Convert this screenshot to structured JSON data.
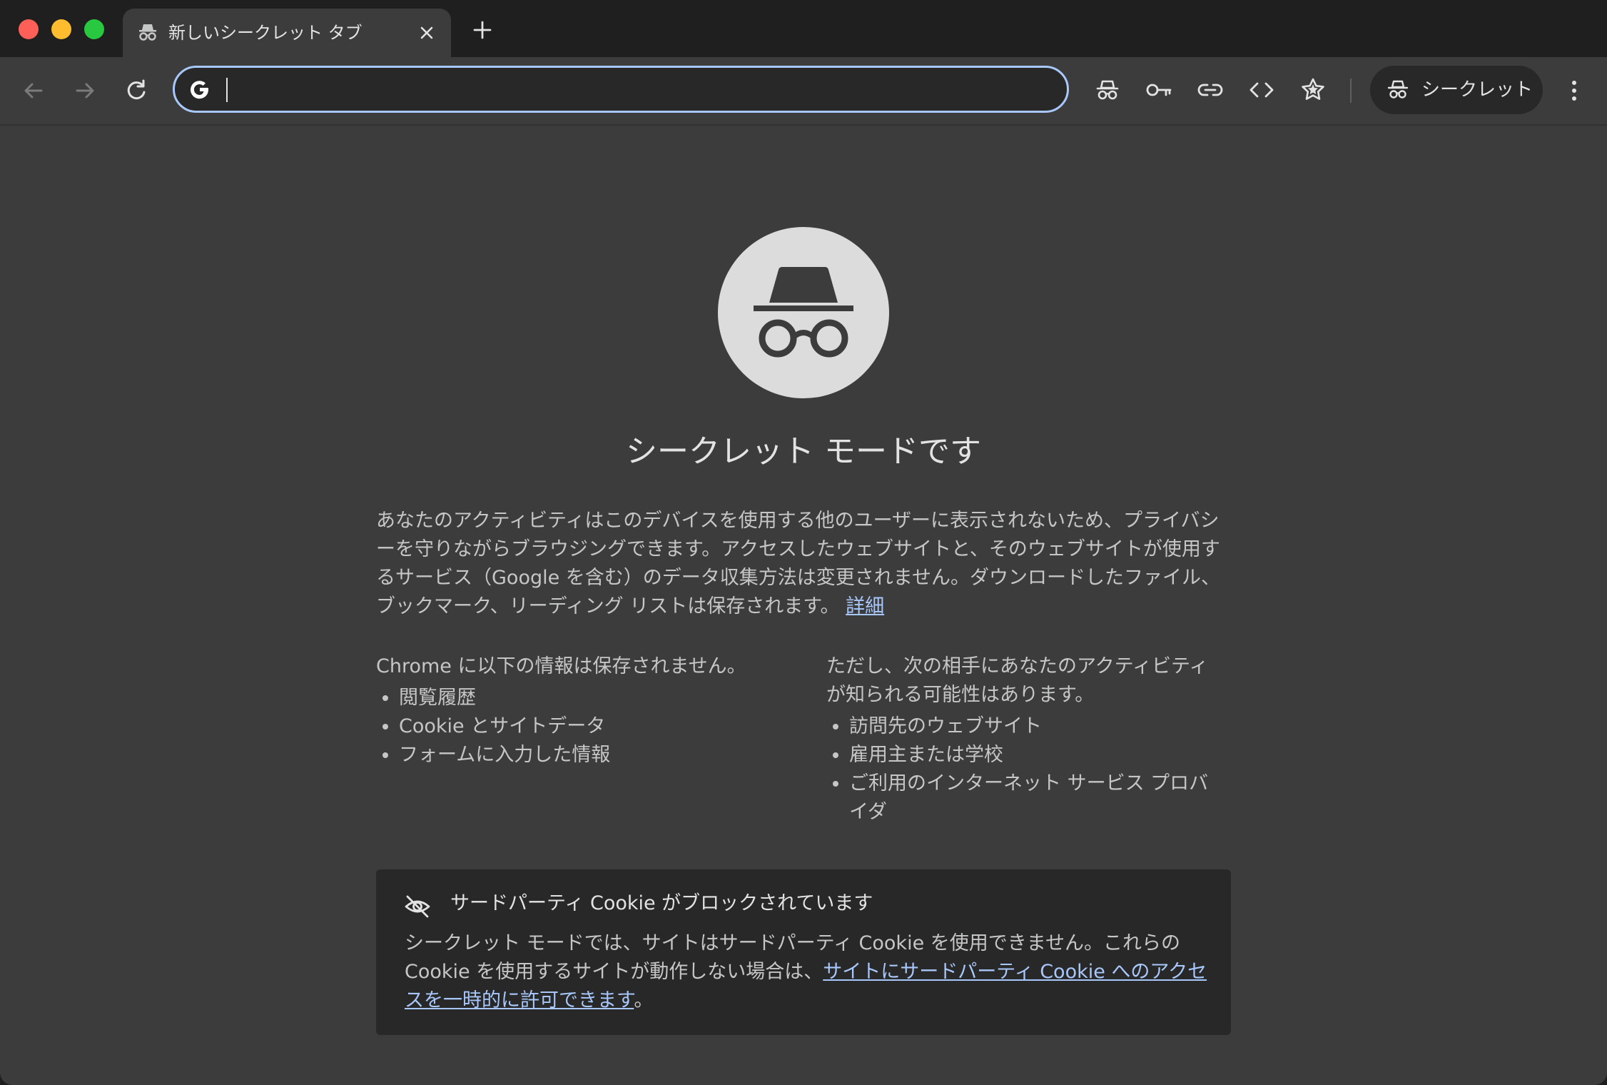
{
  "tab": {
    "title": "新しいシークレット タブ",
    "icon": "incognito-icon"
  },
  "toolbar": {
    "omnibox_value": "",
    "chip_label": "シークレット",
    "icons": [
      "back-arrow-icon",
      "forward-arrow-icon",
      "reload-icon",
      "incognito-icon",
      "key-icon",
      "link-icon",
      "code-icon",
      "bookmark-star-icon",
      "more-vert-icon"
    ]
  },
  "main": {
    "heading": "シークレット モードです",
    "intro_text": "あなたのアクティビティはこのデバイスを使用する他のユーザーに表示されないため、プライバシーを守りながらブラウジングできます。アクセスしたウェブサイトと、そのウェブサイトが使用するサービス（Google を含む）のデータ収集方法は変更されません。ダウンロードしたファイル、ブックマーク、リーディング リストは保存されます。",
    "learn_more": "詳細",
    "left_column": {
      "title": "Chrome に以下の情報は保存されません。",
      "items": [
        "閲覧履歴",
        "Cookie とサイトデータ",
        "フォームに入力した情報"
      ]
    },
    "right_column": {
      "title": "ただし、次の相手にあなたのアクティビティが知られる可能性はあります。",
      "items": [
        "訪問先のウェブサイト",
        "雇用主または学校",
        "ご利用のインターネット サービス プロバイダ"
      ]
    },
    "cookie_notice": {
      "title": "サードパーティ Cookie がブロックされています",
      "body": "シークレット モードでは、サイトはサードパーティ Cookie を使用できません。これらの Cookie を使用するサイトが動作しない場合は、",
      "link": "サイトにサードパーティ Cookie へのアクセスを一時的に許可できます",
      "suffix": "。"
    }
  },
  "colors": {
    "background": "#3c3c3c",
    "frame": "#1f1f1f",
    "accent": "#a8c7fa",
    "text": "#e3e3e3"
  }
}
